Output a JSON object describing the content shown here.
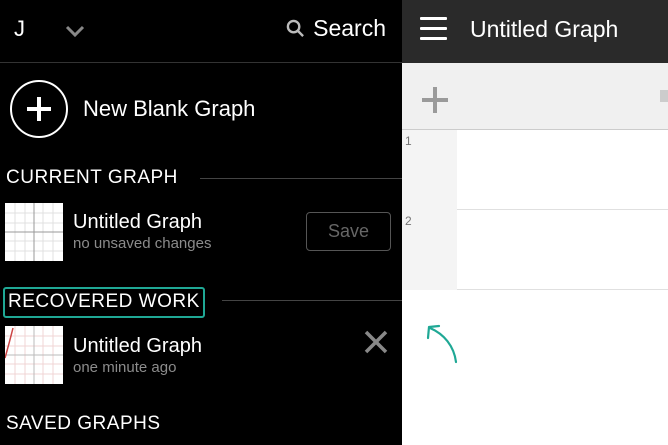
{
  "sidebar": {
    "user_initial": "J",
    "search_label": "Search",
    "new_graph_label": "New Blank Graph",
    "current_section": "CURRENT GRAPH",
    "current_item": {
      "title": "Untitled Graph",
      "subtitle": "no unsaved changes"
    },
    "save_label": "Save",
    "recovered_section": "RECOVERED WORK",
    "recovered_item": {
      "title": "Untitled Graph",
      "subtitle": "one minute ago"
    },
    "saved_section": "SAVED GRAPHS"
  },
  "graph": {
    "title": "Untitled Graph",
    "expressions": [
      {
        "number": "1"
      },
      {
        "number": "2"
      }
    ]
  },
  "colors": {
    "accent": "#1fa895",
    "sidebar_bg": "#000000",
    "header_bg": "#2a2a2a"
  }
}
